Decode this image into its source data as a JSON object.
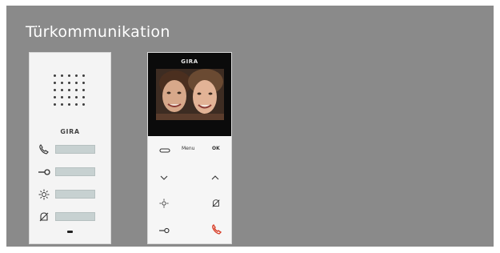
{
  "title": "Türkommunikation",
  "audio_station": {
    "brand": "GIRA",
    "buttons": [
      "call-icon",
      "key-icon",
      "light-icon",
      "bell-off-icon"
    ]
  },
  "video_station": {
    "brand": "GIRA",
    "top_left_icon": "link-icon",
    "menu_label": "Menu",
    "ok_label": "OK",
    "keys": [
      "arrow-down-icon",
      "arrow-up-icon",
      "light-icon",
      "bell-off-icon",
      "key-icon",
      "hangup-icon"
    ]
  },
  "colors": {
    "panel": "#8a8a8a",
    "title": "#ffffff",
    "hangup": "#d9412b"
  }
}
